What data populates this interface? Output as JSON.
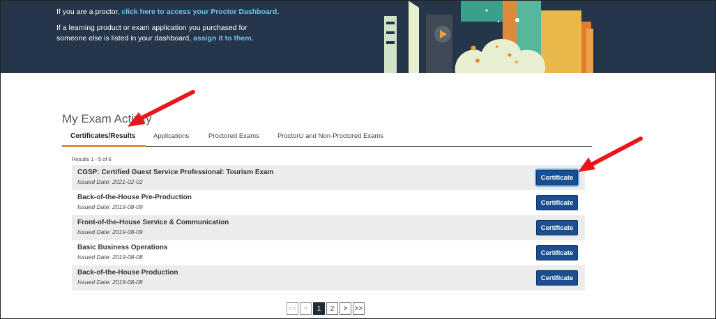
{
  "banner": {
    "proctor_prefix": "If you are a proctor,",
    "proctor_link": "click here to access your Proctor Dashboard",
    "proctor_suffix": ".",
    "assign_line1": "If a learning product or exam application you purchased for",
    "assign_line2_prefix": "someone else is listed in your dashboard,",
    "assign_link": "assign it to them",
    "assign_suffix": "."
  },
  "exam_activity": {
    "heading": "My Exam Activity",
    "tabs": [
      {
        "label": "Certificates/Results",
        "active": true
      },
      {
        "label": "Applications"
      },
      {
        "label": "Proctored Exams"
      },
      {
        "label": "ProctorU and Non-Proctored Exams"
      }
    ],
    "results_count": "Results 1 - 5 of 6",
    "rows": [
      {
        "title": "CGSP: Certified Guest Service Professional: Tourism Exam",
        "issued": "Issued Date: 2021-02-02",
        "button": "Certificate"
      },
      {
        "title": "Back-of-the-House Pre-Production",
        "issued": "Issued Date: 2019-08-09",
        "button": "Certificate"
      },
      {
        "title": "Front-of-the-House Service & Communication",
        "issued": "Issued Date: 2019-08-09",
        "button": "Certificate"
      },
      {
        "title": "Basic Business Operations",
        "issued": "Issued Date: 2019-08-08",
        "button": "Certificate"
      },
      {
        "title": "Back-of-the-House Production",
        "issued": "Issued Date: 2019-08-08",
        "button": "Certificate"
      }
    ]
  },
  "pagination": {
    "first": "<<",
    "prev": "<",
    "pages": [
      "1",
      "2"
    ],
    "current": "1",
    "next": ">",
    "last": ">>"
  },
  "colors": {
    "banner_bg": "#26364a",
    "link": "#6fc3ea",
    "tab_accent": "#e0893a",
    "button_bg": "#1b4e8f",
    "annotation_arrow": "#e8161b"
  }
}
